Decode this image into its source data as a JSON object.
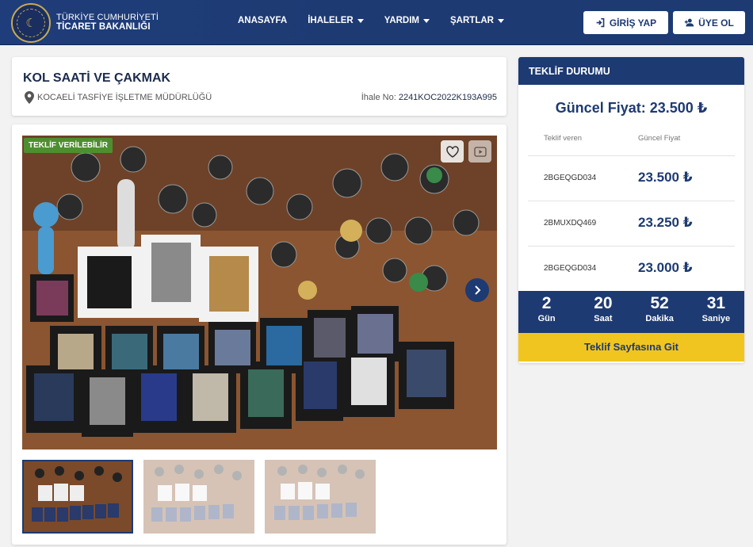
{
  "header": {
    "brand_line1": "TÜRKİYE CUMHURİYETİ",
    "brand_line2": "TİCARET BAKANLIĞI",
    "nav": [
      {
        "label": "ANASAYFA",
        "has_dropdown": false
      },
      {
        "label": "İHALELER",
        "has_dropdown": true
      },
      {
        "label": "YARDIM",
        "has_dropdown": true
      },
      {
        "label": "ŞARTLAR",
        "has_dropdown": true
      }
    ],
    "login_label": "GİRİŞ YAP",
    "register_label": "ÜYE OL"
  },
  "listing": {
    "title": "KOL SAATİ VE ÇAKMAK",
    "location": "KOCAELİ TASFİYE İŞLETME MÜDÜRLÜĞÜ",
    "ihale_label": "İhale No:",
    "ihale_no": "2241KOC2022K193A995",
    "badge": "TEKLİF VERİLEBİLİR",
    "thumbnail_count": 3
  },
  "offer": {
    "heading": "TEKLİF DURUMU",
    "current_price_text": "Güncel Fiyat: 23.500 ₺",
    "col_bidder": "Teklif veren",
    "col_price": "Güncel Fiyat",
    "bids": [
      {
        "bidder": "2BGEQGD034",
        "amount": "23.500 ₺"
      },
      {
        "bidder": "2BMUXDQ469",
        "amount": "23.250 ₺"
      },
      {
        "bidder": "2BGEQGD034",
        "amount": "23.000 ₺"
      }
    ],
    "countdown": [
      {
        "value": "2",
        "label": "Gün"
      },
      {
        "value": "20",
        "label": "Saat"
      },
      {
        "value": "52",
        "label": "Dakika"
      },
      {
        "value": "31",
        "label": "Saniye"
      }
    ],
    "go_button": "Teklif Sayfasına Git"
  },
  "colors": {
    "navy": "#1d3a72",
    "accent_yellow": "#f1c51f",
    "badge_green": "#4d8f2f"
  }
}
